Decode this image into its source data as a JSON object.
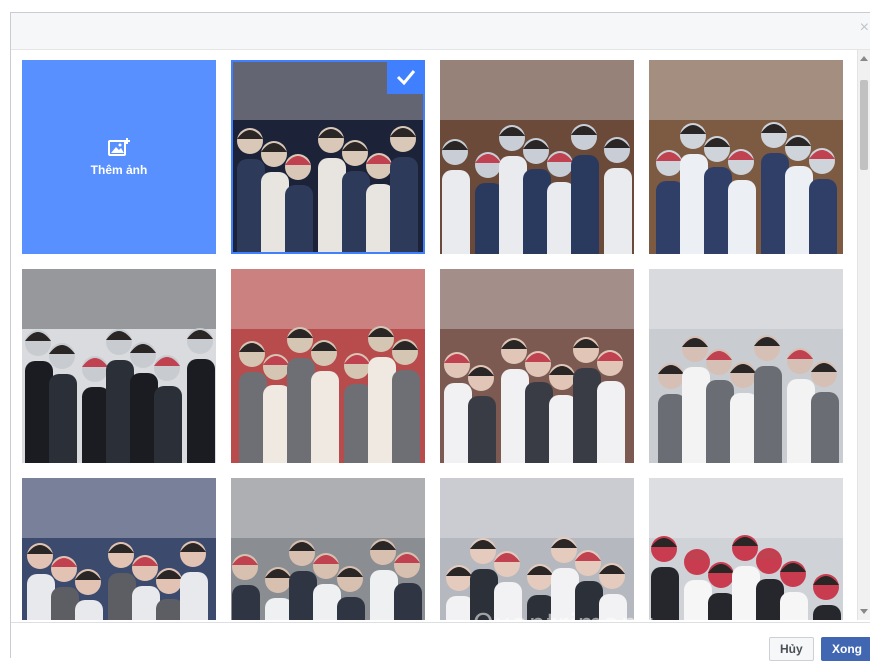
{
  "dialog": {
    "close_glyph": "×",
    "add_photo": {
      "label": "Thêm ảnh",
      "icon": "add-photo-icon"
    },
    "photos": [
      {
        "name": "photo-1",
        "selected": true,
        "palette": [
          "#1c2338",
          "#e8e4df",
          "#2e3a5a",
          "#d9c7b8"
        ]
      },
      {
        "name": "photo-2",
        "selected": false,
        "palette": [
          "#6b4a3a",
          "#e9ebef",
          "#2a3a5e",
          "#c9ced6"
        ]
      },
      {
        "name": "photo-3",
        "selected": false,
        "palette": [
          "#7d5b43",
          "#eceff3",
          "#2f3f68",
          "#cfd3da"
        ]
      },
      {
        "name": "photo-4",
        "selected": false,
        "palette": [
          "#d9dbde",
          "#1a1c22",
          "#2b2f38",
          "#c8cbd0"
        ]
      },
      {
        "name": "photo-5",
        "selected": false,
        "palette": [
          "#b84b4b",
          "#efe9e2",
          "#6d6f75",
          "#d5c5b3"
        ]
      },
      {
        "name": "photo-6",
        "selected": false,
        "palette": [
          "#7c5a52",
          "#f1f1f3",
          "#3a3c45",
          "#e1c6b8"
        ]
      },
      {
        "name": "photo-7",
        "selected": false,
        "palette": [
          "#c9cdd2",
          "#f3f3f4",
          "#6a6d73",
          "#d6c0b5"
        ]
      },
      {
        "name": "photo-8",
        "selected": false,
        "palette": [
          "#3c4a6e",
          "#e8e9ec",
          "#5d5e63",
          "#e2c3b3"
        ]
      },
      {
        "name": "photo-9",
        "selected": false,
        "palette": [
          "#8a8d92",
          "#eff0f2",
          "#2f3542",
          "#d8c0b0"
        ]
      },
      {
        "name": "photo-10",
        "selected": false,
        "palette": [
          "#b5b9bf",
          "#f2f2f4",
          "#2c3038",
          "#e4cbbd"
        ]
      },
      {
        "name": "photo-11",
        "selected": false,
        "palette": [
          "#cfd2d6",
          "#f6f6f7",
          "#25272d",
          "#c93c50"
        ]
      }
    ],
    "buttons": {
      "cancel": "Hủy",
      "done": "Xong"
    },
    "watermark": "Quantrimang"
  }
}
